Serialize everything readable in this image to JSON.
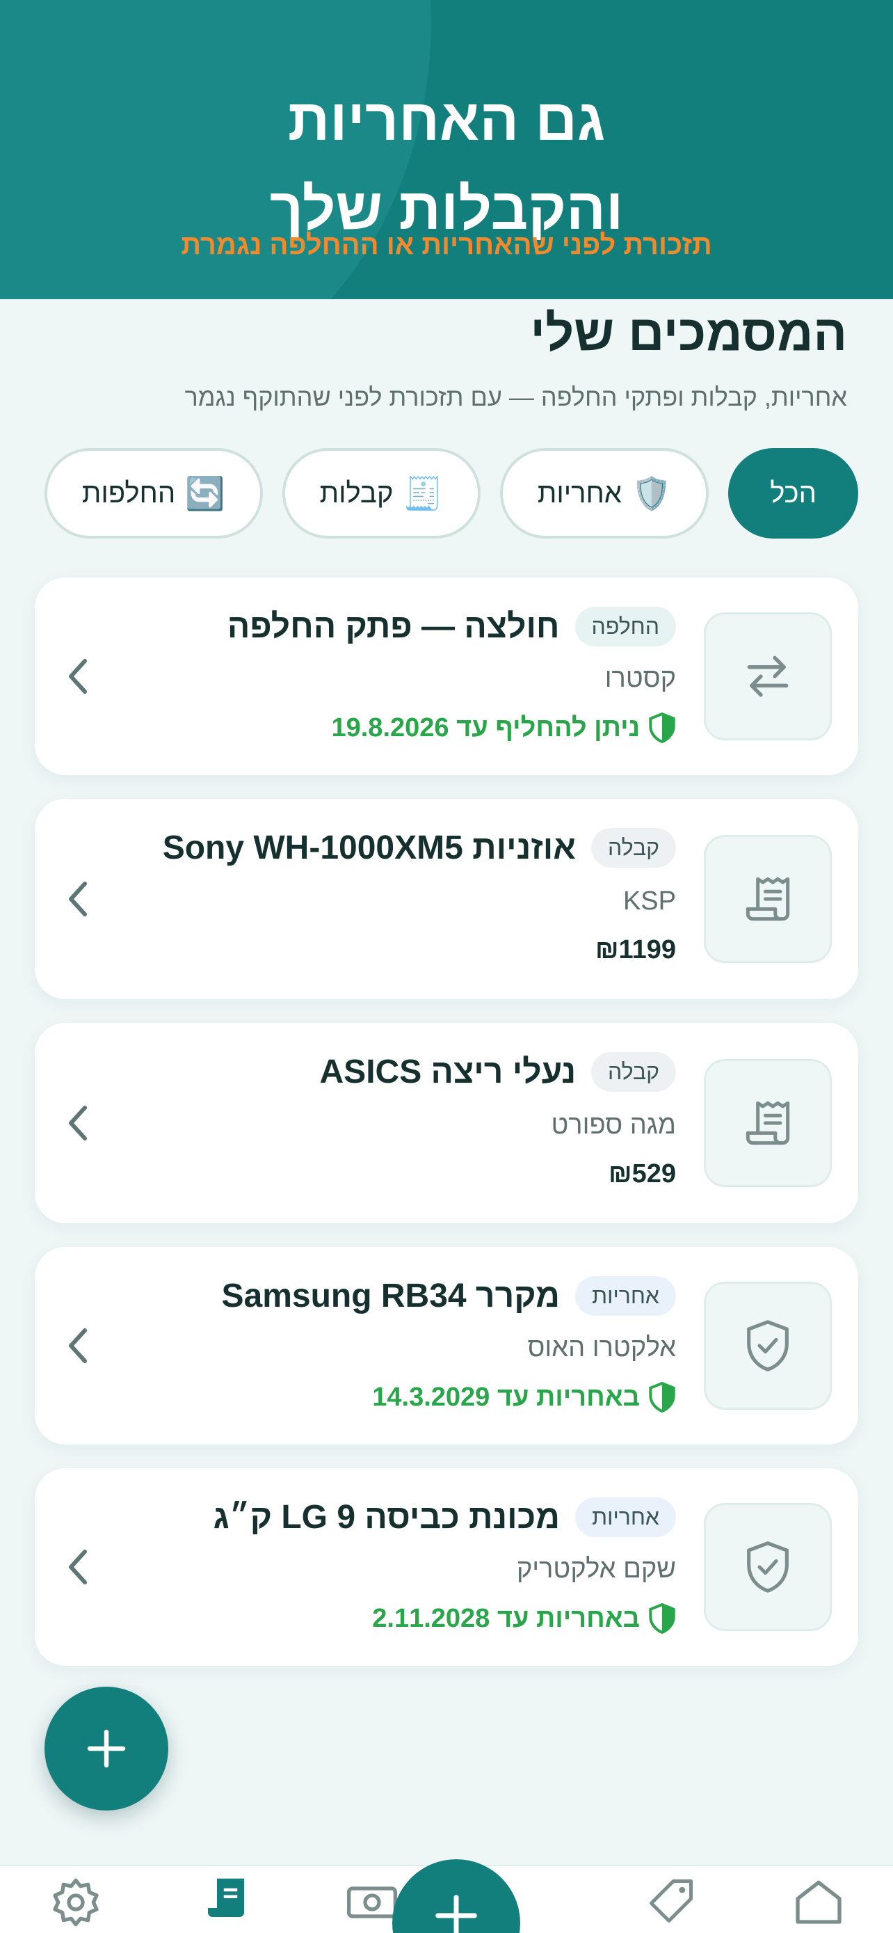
{
  "header": {
    "title": "גם האחריות\nוהקבלות שלך",
    "subtitle": "תזכורת לפני שהאחריות או ההחלפה נגמרת"
  },
  "section": {
    "title": "המסמכים שלי",
    "subtitle": "אחריות, קבלות ופתקי החלפה — עם תזכורת לפני שהתוקף נגמר"
  },
  "filters": [
    {
      "label": "הכל",
      "icon": "",
      "active": true
    },
    {
      "label": "אחריות",
      "icon": "🛡️",
      "active": false
    },
    {
      "label": "קבלות",
      "icon": "🧾",
      "active": false
    },
    {
      "label": "החלפות",
      "icon": "🔄",
      "active": false
    }
  ],
  "documents": [
    {
      "badge": "החלפה",
      "title": "חולצה — פתק החלפה",
      "store": "קסטרו",
      "meta": "ניתן להחליף עד 19.8.2026",
      "icon": "swap-icon"
    },
    {
      "badge": "קבלה",
      "title": "אוזניות Sony WH-1000XM5",
      "store": "KSP",
      "meta": "₪1199",
      "icon": "receipt-icon"
    },
    {
      "badge": "קבלה",
      "title": "נעלי ריצה ASICS",
      "store": "מגה ספורט",
      "meta": "₪529",
      "icon": "receipt-icon"
    },
    {
      "badge": "אחריות",
      "title": "מקרר Samsung RB34",
      "store": "אלקטרו האוס",
      "meta": "באחריות עד 14.3.2029",
      "icon": "shield-check-icon"
    },
    {
      "badge": "אחריות",
      "title": "מכונת כביסה LG 9 ק״ג",
      "store": "שקם אלקטריק",
      "meta": "באחריות עד 2.11.2028",
      "icon": "shield-check-icon"
    }
  ],
  "colors": {
    "primary": "#127f7d",
    "accent": "#f08a2c",
    "valid": "#2aa64a"
  },
  "nav": {
    "items": [
      "home-icon",
      "tag-icon",
      "add-icon",
      "money-icon",
      "documents-icon",
      "settings-icon"
    ],
    "active": "documents-icon"
  }
}
